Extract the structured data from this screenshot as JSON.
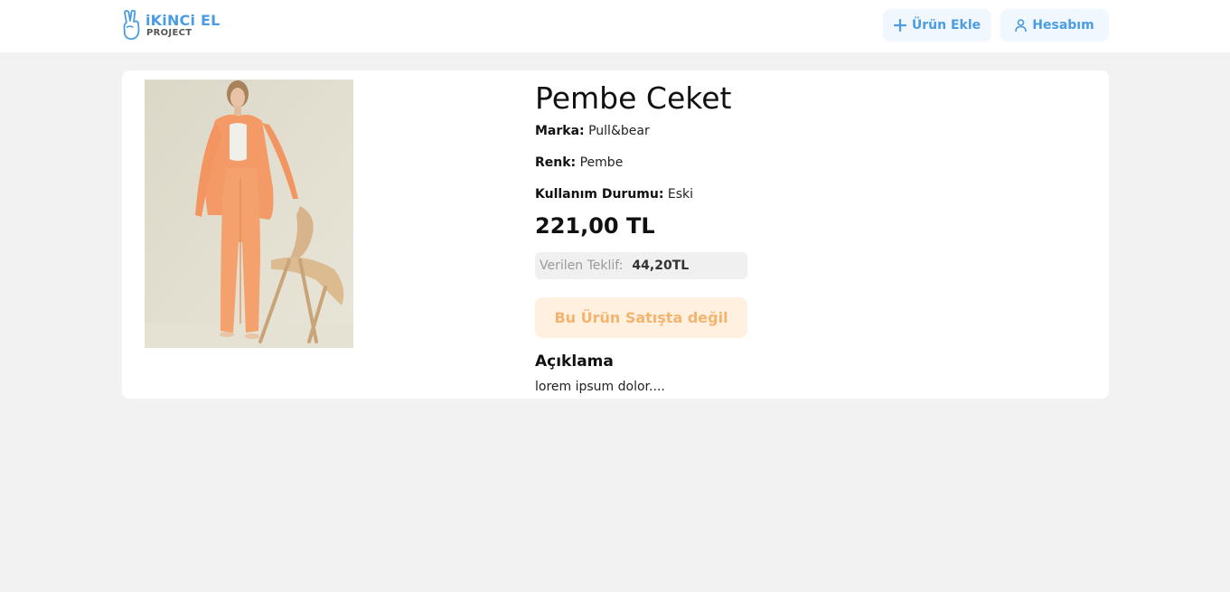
{
  "header": {
    "logo": {
      "title": "iKiNCi EL",
      "subtitle": "PROJECT"
    },
    "add_product_label": "Ürün Ekle",
    "account_label": "Hesabım"
  },
  "product": {
    "title": "Pembe Ceket",
    "brand_label": "Marka:",
    "brand": "Pull&bear",
    "color_label": "Renk:",
    "color": "Pembe",
    "condition_label": "Kullanım Durumu:",
    "condition": "Eski",
    "price": "221,00 TL",
    "offer_label": "Verilen Teklif:",
    "offer_value": "44,20TL",
    "status_button": "Bu Ürün Satışta değil",
    "description_title": "Açıklama",
    "description": "lorem ipsum dolor...."
  },
  "colors": {
    "brand_blue": "#4b9ce2",
    "nav_button_bg": "#f0f7fe",
    "disabled_button_bg": "#fff0e0",
    "disabled_button_text": "#f5b46e",
    "page_bg": "#f2f2f2"
  },
  "icons": {
    "logo": "hand-peace-icon",
    "add": "plus-icon",
    "account": "user-icon"
  }
}
